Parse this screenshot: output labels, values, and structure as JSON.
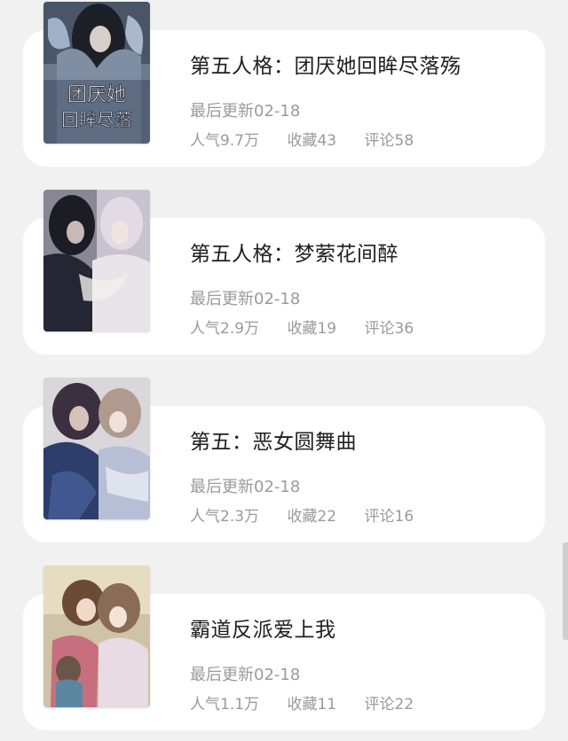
{
  "items": [
    {
      "title": "第五人格：团厌她回眸尽落殇",
      "updated": "最后更新02-18",
      "popularity": "人气9.7万",
      "favorites": "收藏43",
      "comments": "评论58",
      "cover_text_top": "团厌她",
      "cover_text_bottom": "回眸尽落"
    },
    {
      "title": "第五人格：梦萦花间醉",
      "updated": "最后更新02-18",
      "popularity": "人气2.9万",
      "favorites": "收藏19",
      "comments": "评论36"
    },
    {
      "title": "第五：恶女圆舞曲",
      "updated": "最后更新02-18",
      "popularity": "人气2.3万",
      "favorites": "收藏22",
      "comments": "评论16"
    },
    {
      "title": "霸道反派爱上我",
      "updated": "最后更新02-18",
      "popularity": "人气1.1万",
      "favorites": "收藏11",
      "comments": "评论22"
    }
  ]
}
